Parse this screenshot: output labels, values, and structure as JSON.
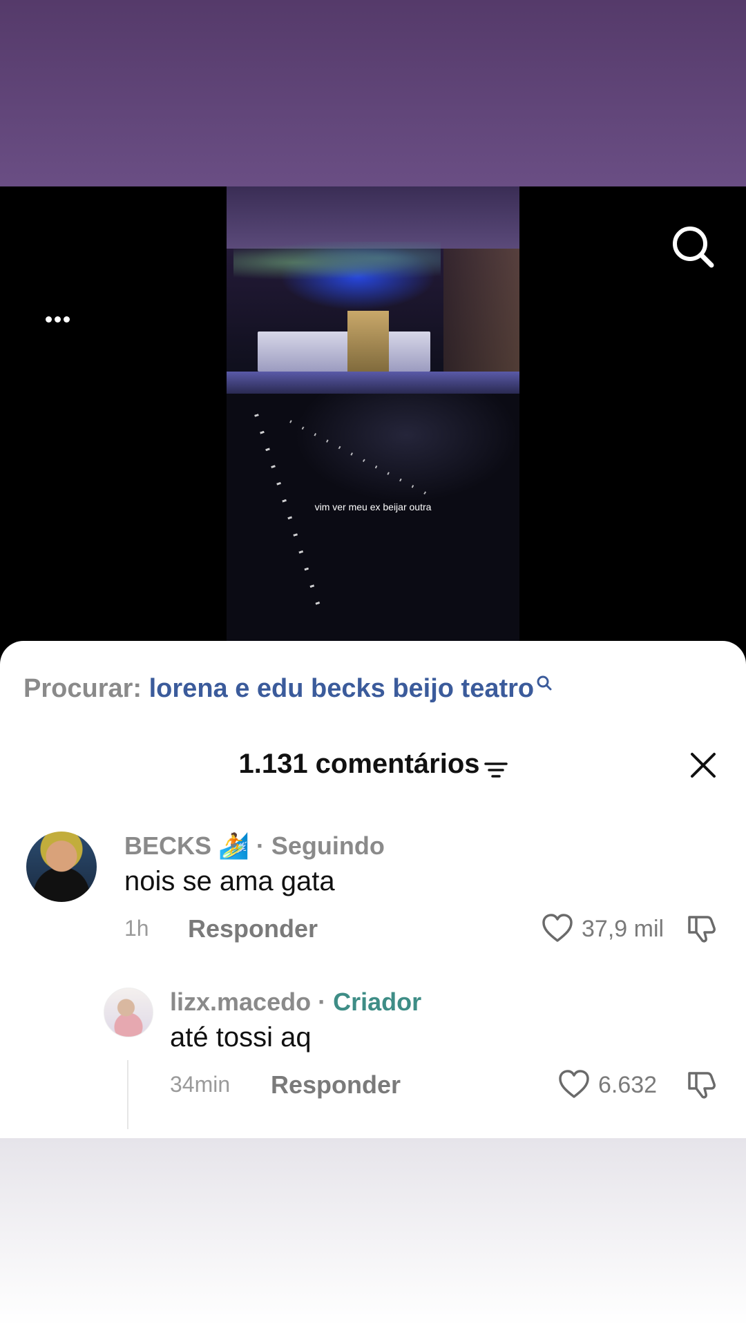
{
  "video": {
    "caption": "vim ver meu ex beijar outra"
  },
  "icons": {
    "more": "more-horizontal-icon",
    "search": "search-icon",
    "filter": "filter-icon",
    "close": "close-icon",
    "like": "heart-icon",
    "dislike": "thumbs-down-icon"
  },
  "search_suggestion": {
    "label": "Procurar:",
    "term": "lorena e edu becks beijo teatro"
  },
  "comments_header": {
    "count_text": "1.131 comentários"
  },
  "comments": [
    {
      "author": "BECKS 🏄",
      "separator": " · ",
      "tag": "Seguindo",
      "text": "nois se ama gata",
      "time": "1h",
      "reply_label": "Responder",
      "likes": "37,9 mil"
    },
    {
      "author": "lizx.macedo",
      "separator": " · ",
      "tag": "Criador",
      "text": "até tossi aq",
      "time": "34min",
      "reply_label": "Responder",
      "likes": "6.632"
    }
  ],
  "colors": {
    "top_band": "#5e4475",
    "accent_link": "#3b5b9b",
    "creator_tag": "#3e8d86"
  }
}
